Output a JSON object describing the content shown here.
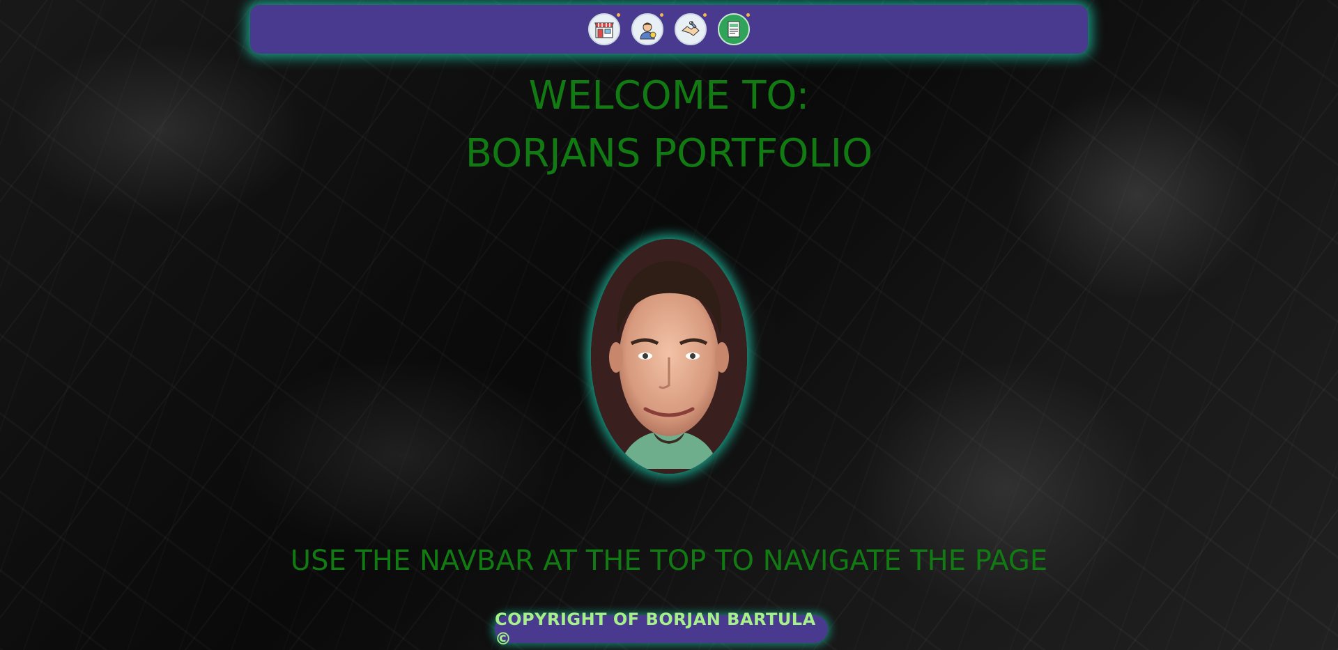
{
  "navbar": {
    "items": [
      {
        "icon": "store-icon"
      },
      {
        "icon": "person-idea-icon"
      },
      {
        "icon": "handshake-wrench-icon"
      },
      {
        "icon": "newspaper-icon"
      }
    ]
  },
  "heading": {
    "line1": "WELCOME TO:",
    "line2": "BORJANS PORTFOLIO"
  },
  "hint": "USE THE NAVBAR AT THE TOP TO NAVIGATE THE PAGE",
  "footer": {
    "text": "COPYRIGHT OF BORJAN BARTULA ©"
  },
  "colors": {
    "accent_green": "#127a12",
    "nav_purple": "#4a3a8f",
    "glow_teal": "#1ec8aa",
    "footer_text": "#a6f08a"
  }
}
